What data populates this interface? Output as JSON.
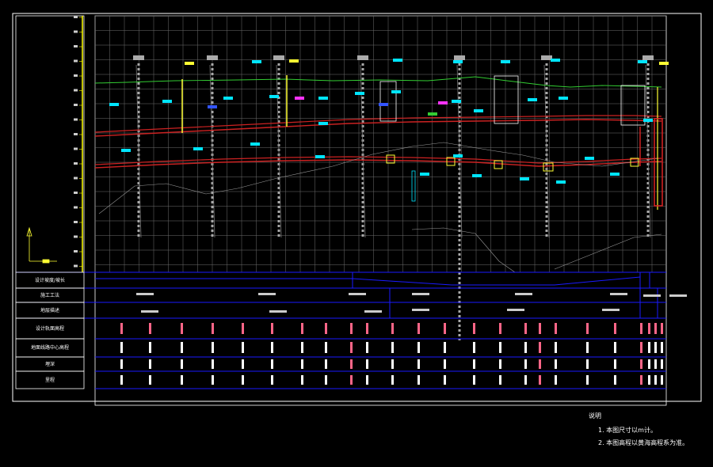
{
  "drawing": {
    "colors": {
      "frame": "#ffffff",
      "grid": "#8a8a8a",
      "table_lines": "#1a1aff",
      "ground_line": "#33cc33",
      "design_line": "#cc2222",
      "scale_axis": "#ffff00",
      "borehole": "#b0b0b0",
      "annotation_cyan": "#00e5ff",
      "annotation_magenta": "#ff33ff",
      "annotation_yellow": "#ffff33",
      "annotation_white": "#ffffff",
      "table_value_pink": "#ff6688"
    },
    "row_headers": [
      "设计坡度/坡长",
      "施工工法",
      "地层描述",
      "设计轨面高程",
      "地面线路中心高程",
      "埋深",
      "里程"
    ],
    "notes": {
      "title": "说明",
      "items": [
        "1. 本图尺寸以m计。",
        "2. 本图高程以黄海高程系为准。"
      ]
    }
  }
}
